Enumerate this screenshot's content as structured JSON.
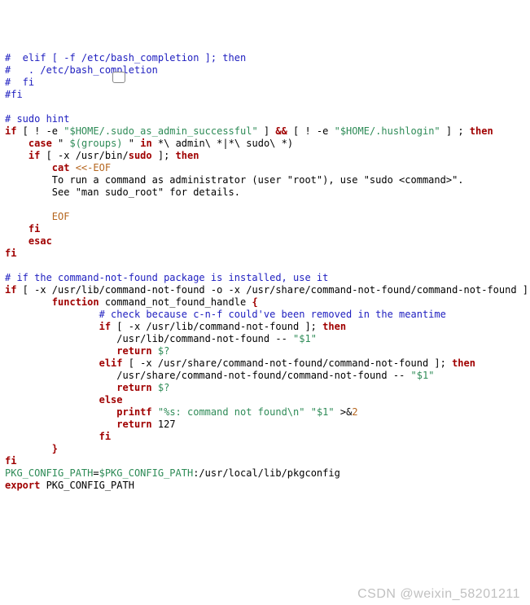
{
  "watermark": "CSDN @weixin_58201211",
  "code": {
    "l01a": "#  elif [ -f /etc/bash_completion ]; then",
    "l01b": "#   . /etc/bash_completion",
    "l01c": "#  fi",
    "l01d": "#fi",
    "l03": "# sudo hint",
    "l04_if": "if",
    "l04_b1": " [ ! -e ",
    "l04_v1": "\"$HOME/.sudo_as_admin_successful\"",
    "l04_b2": " ] ",
    "l04_and": "&&",
    "l04_b3": " [ ! -e ",
    "l04_v2": "\"$HOME/.hushlogin\"",
    "l04_b4": " ] ; ",
    "l04_then": "then",
    "l05_case": "case",
    "l05_a": " \" ",
    "l05_v": "$(groups)",
    "l05_b": " \" ",
    "l05_in": "in",
    "l05_c": " *\\ admin\\ *|*\\ sudo\\ *)",
    "l06_if": "if",
    "l06_a": " [ -x /usr/bin/",
    "l06_sudo": "sudo",
    "l06_b": " ]; ",
    "l06_then": "then",
    "l07_cat": "cat",
    "l07_her": " <<-EOF",
    "l08": "To run a command as administrator (user \"root\"), use \"sudo <command>\".",
    "l09": "See \"man sudo_root\" for details.",
    "l11": "EOF",
    "l12": "fi",
    "l13": "esac",
    "l14": "fi",
    "l16": "# if the command-not-found package is installed, use it",
    "l17_if": "if",
    "l17_a": " [ -x /usr/lib/command-not-found -o -x /usr/share/command-not-found/command-not-found ];",
    "l18_fn": "function",
    "l18_name": " command_not_found_handle ",
    "l18_ob": "{",
    "l19": "# check because c-n-f could've been removed in the meantime",
    "l20_if": "if",
    "l20_a": " [ -x /usr/lib/command-not-found ]; ",
    "l20_then": "then",
    "l21_p": "/usr/lib/command-not-found -- ",
    "l21_v": "\"$1\"",
    "l22_ret": "return",
    "l22_v": " $?",
    "l23_elif": "elif",
    "l23_a": " [ -x /usr/share/command-not-found/command-not-found ]; ",
    "l23_then": "then",
    "l24_p": "/usr/share/command-not-found/command-not-found -- ",
    "l24_v": "\"$1\"",
    "l25_ret": "return",
    "l25_v": " $?",
    "l26": "else",
    "l27_pf": "printf",
    "l27_s": " \"%s: command not found\\n\" ",
    "l27_v": "\"$1\"",
    "l27_r": " >&",
    "l27_n": "2",
    "l28_ret": "return",
    "l28_v": " 127",
    "l29": "fi",
    "l30": "}",
    "l31": "fi",
    "l32_k": "PKG_CONFIG_PATH",
    "l32_a": "=",
    "l32_v": "$PKG_CONFIG_PATH",
    "l32_b": ":/usr/local/lib/pkgconfig",
    "l33_e": "export",
    "l33_v": " PKG_CONFIG_PATH"
  }
}
